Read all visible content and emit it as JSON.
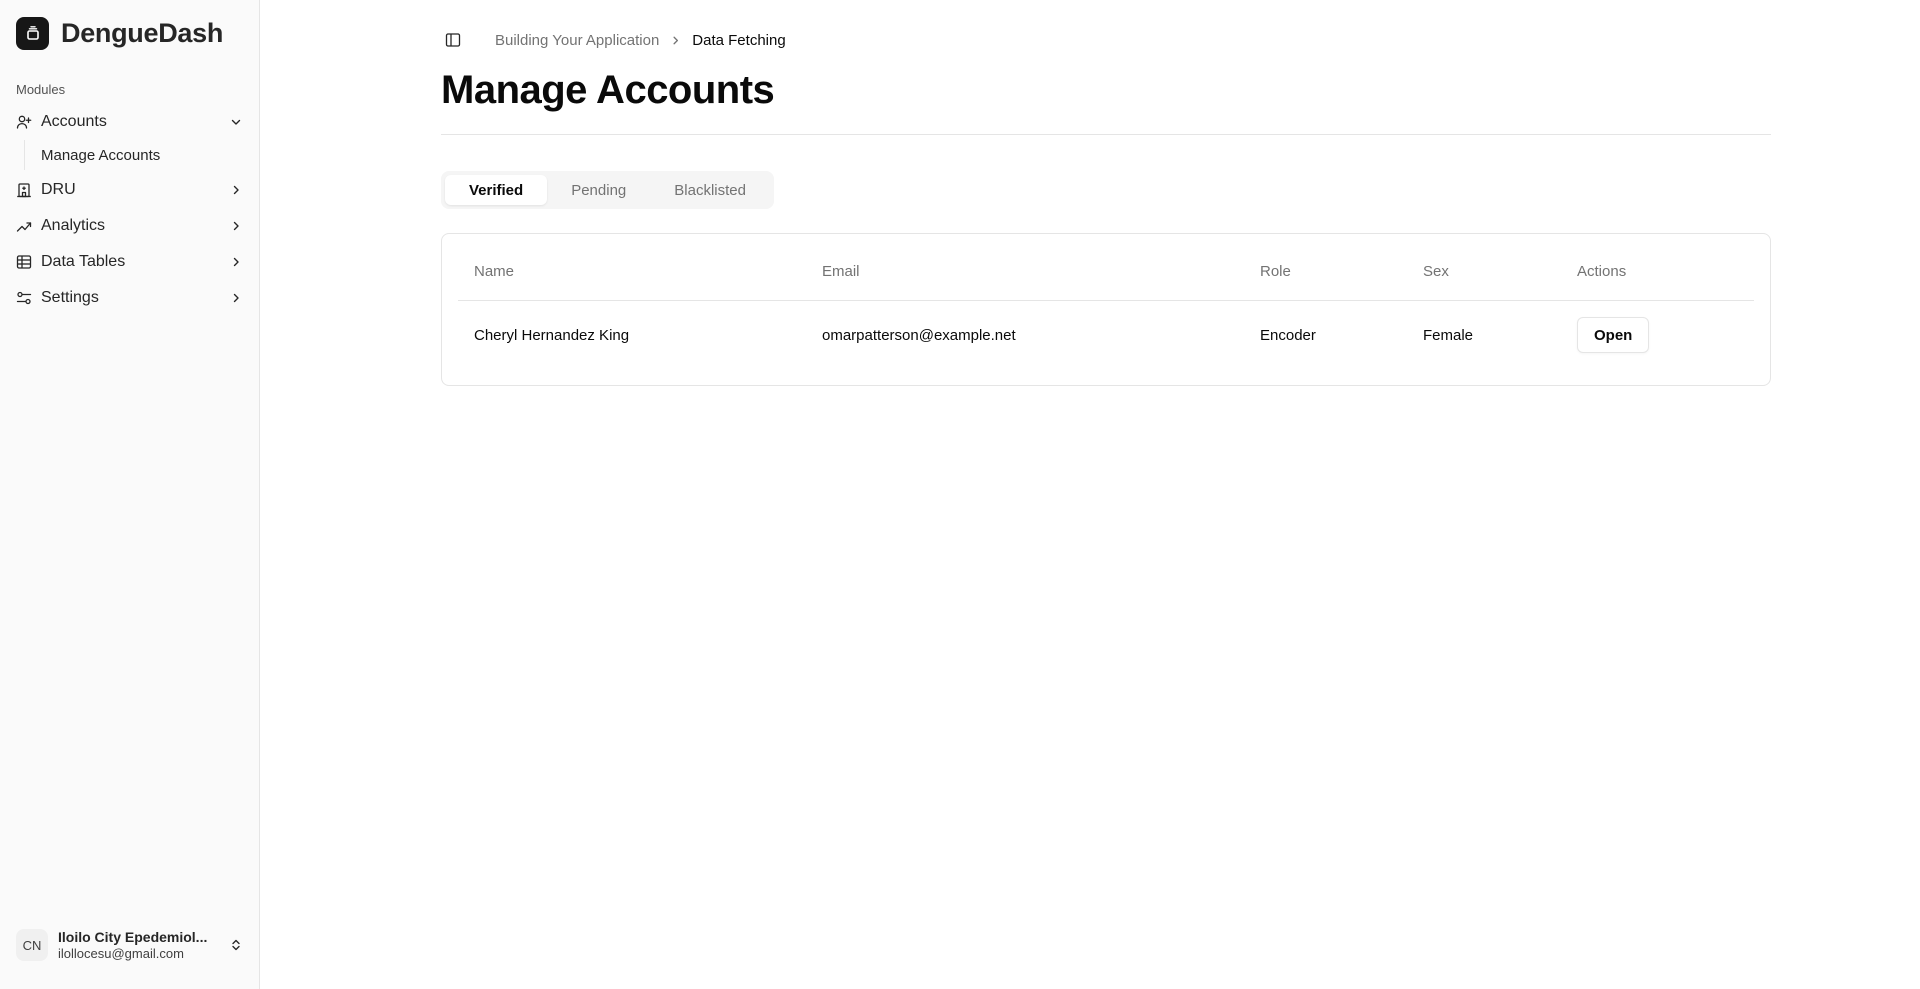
{
  "app": {
    "name": "DengueDash"
  },
  "sidebar": {
    "section_label": "Modules",
    "items": [
      {
        "label": "Accounts",
        "icon": "user-plus-icon",
        "expanded": true,
        "children": [
          {
            "label": "Manage Accounts"
          }
        ]
      },
      {
        "label": "DRU",
        "icon": "hospital-icon"
      },
      {
        "label": "Analytics",
        "icon": "trend-icon"
      },
      {
        "label": "Data Tables",
        "icon": "table-icon"
      },
      {
        "label": "Settings",
        "icon": "sliders-icon"
      }
    ],
    "user": {
      "initials": "CN",
      "name": "Iloilo City Epedemiol...",
      "email": "ilollocesu@gmail.com"
    }
  },
  "breadcrumb": {
    "parent": "Building Your Application",
    "current": "Data Fetching"
  },
  "page": {
    "title": "Manage Accounts"
  },
  "tabs": [
    {
      "label": "Verified",
      "active": true
    },
    {
      "label": "Pending",
      "active": false
    },
    {
      "label": "Blacklisted",
      "active": false
    }
  ],
  "table": {
    "columns": [
      "Name",
      "Email",
      "Role",
      "Sex",
      "Actions"
    ],
    "rows": [
      {
        "name": "Cheryl Hernandez King",
        "email": "omarpatterson@example.net",
        "role": "Encoder",
        "sex": "Female",
        "action": "Open"
      }
    ]
  }
}
